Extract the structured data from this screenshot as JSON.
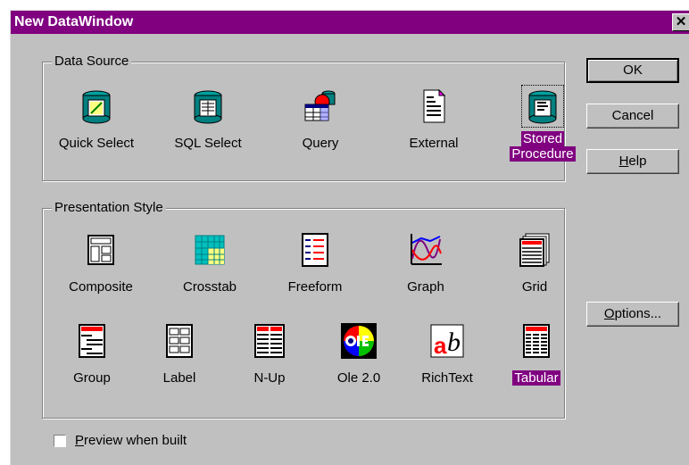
{
  "window": {
    "title": "New DataWindow",
    "close_glyph": "✕"
  },
  "data_source": {
    "label": "Data Source",
    "items": [
      {
        "label": "Quick Select",
        "icon": "quick-select-icon",
        "selected": false
      },
      {
        "label": "SQL Select",
        "icon": "sql-select-icon",
        "selected": false
      },
      {
        "label": "Query",
        "icon": "query-icon",
        "selected": false
      },
      {
        "label": "External",
        "icon": "external-icon",
        "selected": false
      },
      {
        "label_line1": "Stored",
        "label_line2": "Procedure",
        "icon": "stored-procedure-icon",
        "selected": true
      }
    ]
  },
  "presentation_style": {
    "label": "Presentation Style",
    "items": [
      {
        "label": "Composite",
        "icon": "composite-icon"
      },
      {
        "label": "Crosstab",
        "icon": "crosstab-icon"
      },
      {
        "label": "Freeform",
        "icon": "freeform-icon"
      },
      {
        "label": "Graph",
        "icon": "graph-icon"
      },
      {
        "label": "Grid",
        "icon": "grid-icon"
      },
      {
        "label": "Group",
        "icon": "group-icon"
      },
      {
        "label": "Label",
        "icon": "label-icon"
      },
      {
        "label": "N-Up",
        "icon": "n-up-icon"
      },
      {
        "label": "Ole 2.0",
        "icon": "ole-icon"
      },
      {
        "label": "RichText",
        "icon": "richtext-icon"
      },
      {
        "label": "Tabular",
        "icon": "tabular-icon",
        "selected": true
      }
    ]
  },
  "buttons": {
    "ok": "OK",
    "cancel": "Cancel",
    "help_mnemonic": "H",
    "help_rest": "elp",
    "options_mnemonic": "O",
    "options_rest": "ptions..."
  },
  "preview": {
    "mnemonic": "P",
    "rest": "review when built",
    "checked": false
  },
  "colors": {
    "title_bar": "#800080",
    "selection": "#800080",
    "face": "#c0c0c0",
    "teal": "#008080"
  }
}
